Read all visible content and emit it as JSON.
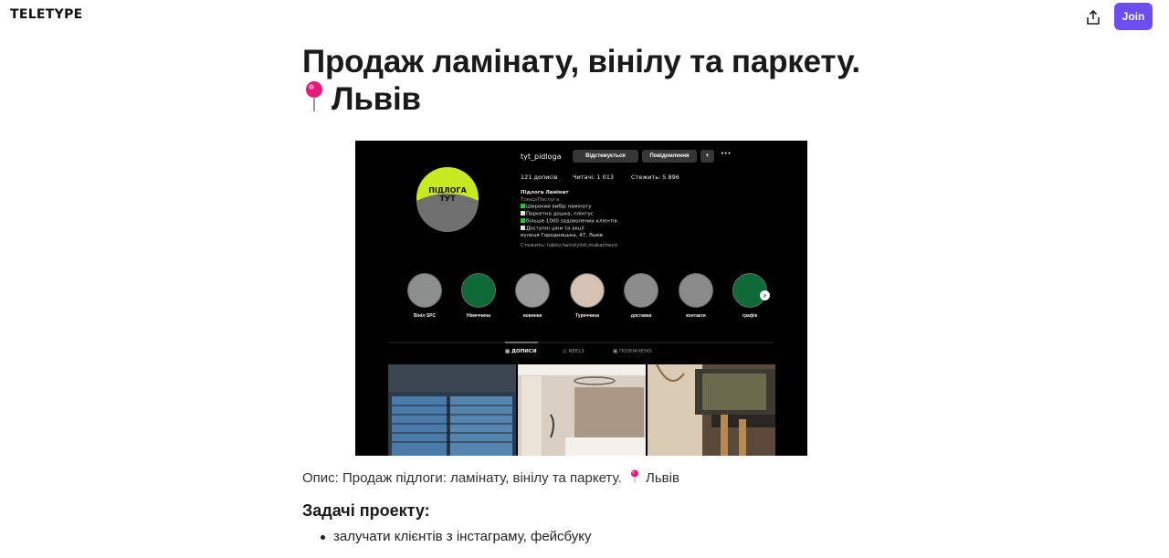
{
  "header": {
    "logo": "TELETYPE",
    "join_label": "Join"
  },
  "article": {
    "title_line1": "Продаж ламінату, вінілу та паркету.",
    "title_line2": "Львів",
    "caption": "Опис: Продаж підлоги: ламінату, вінілу та паркету.",
    "caption_city": "Львів",
    "section_heading": "Задачі проекту:",
    "bullets": [
      "залучати клієнтів з інстаграму, фейсбуку"
    ]
  },
  "instagram": {
    "username": "tyt_pidloga",
    "follow_label": "Відстежується",
    "message_label": "Повідомлення",
    "posts": "121 дописів",
    "followers": "Читачі: 1 013",
    "following": "Стежить: 5 896",
    "avatar_text_1": "ПІДЛОГА",
    "avatar_text_2": "ТУТ",
    "bio": {
      "name": "Підлога Ламінат",
      "category": "Товар/Послуга",
      "lines": [
        "Широкий вибір ламінату",
        "Паркетна дошка, плінтус",
        "більше 1000 задоволених клієнтів",
        "Доступні ціни та акції",
        "вулиця Городницька, 47, Львів"
      ],
      "followed_by": "Стежить: lubov.hairstylist.mukachevo"
    },
    "highlights": [
      {
        "label": "Вініл SPC"
      },
      {
        "label": "Німеччина"
      },
      {
        "label": "новинки"
      },
      {
        "label": "Туреччина"
      },
      {
        "label": "доставка"
      },
      {
        "label": "контакти"
      },
      {
        "label": "графік"
      }
    ],
    "tabs": [
      "ДОПИСИ",
      "REELS",
      "ПОЗНАЧЕНО"
    ]
  },
  "colors": {
    "join_button": "#6b4ef0",
    "pin": "#e6197d",
    "avatar_bg": "#c7e91f"
  }
}
